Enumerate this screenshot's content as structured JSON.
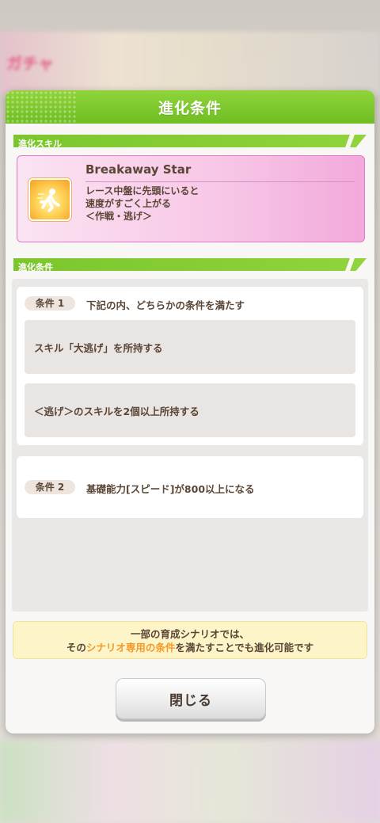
{
  "background": {
    "header_text": "ガチャ"
  },
  "modal": {
    "title": "進化条件",
    "skill_section_label": "進化スキル",
    "condition_section_label": "進化条件",
    "close_label": "閉じる"
  },
  "skill": {
    "name": "Breakaway Star",
    "desc_line1": "レース中盤に先頭にいると",
    "desc_line2": "速度がすごく上がる",
    "desc_line3": "＜作戦・逃げ＞",
    "icon": "running-figure-icon"
  },
  "conditions": [
    {
      "tag": "条件 1",
      "text": "下記の内、どちらかの条件を満たす",
      "subs": [
        "スキル「大逃げ」を所持する",
        "＜逃げ＞のスキルを2個以上所持する"
      ]
    },
    {
      "tag": "条件 2",
      "text": "基礎能力[スピード]が800以上になる"
    }
  ],
  "note": {
    "line1": "一部の育成シナリオでは、",
    "line2_prefix": "その",
    "line2_highlight": "シナリオ専用の条件",
    "line2_suffix": "を満たすことでも進化可能です",
    "highlight_color": "#f29a2b"
  },
  "colors": {
    "accent_green": "#7cc62d",
    "skill_pink": "#f2a9dc",
    "text_brown": "#5a4636"
  }
}
